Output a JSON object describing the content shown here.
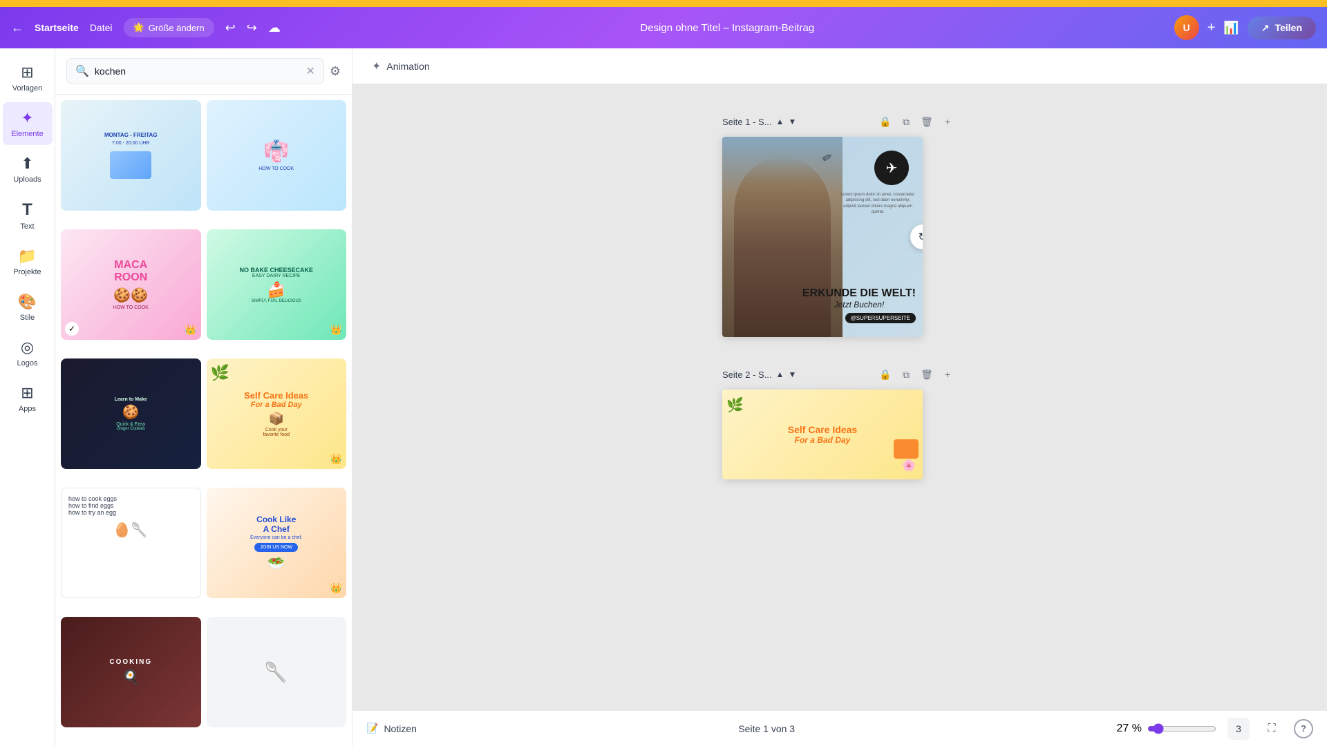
{
  "topbar": {
    "home_label": "Startseite",
    "file_label": "Datei",
    "resize_label": "Größe ändern",
    "title": "Design ohne Titel – Instagram-Beitrag",
    "share_label": "Teilen",
    "undo_icon": "↩",
    "redo_icon": "↪",
    "cloud_icon": "☁",
    "plus_icon": "+",
    "stats_icon": "📊"
  },
  "sidebar": {
    "items": [
      {
        "id": "vorlagen",
        "label": "Vorlagen",
        "icon": "⊞",
        "active": false
      },
      {
        "id": "elemente",
        "label": "Elemente",
        "icon": "✦",
        "active": true
      },
      {
        "id": "uploads",
        "label": "Uploads",
        "icon": "⬆",
        "active": false
      },
      {
        "id": "text",
        "label": "Text",
        "icon": "T",
        "active": false
      },
      {
        "id": "projekte",
        "label": "Projekte",
        "icon": "📁",
        "active": false
      },
      {
        "id": "stile",
        "label": "Stile",
        "icon": "🎨",
        "active": false
      },
      {
        "id": "logos",
        "label": "Logos",
        "icon": "◎",
        "active": false
      },
      {
        "id": "apps",
        "label": "Apps",
        "icon": "⊞",
        "active": false
      }
    ]
  },
  "search": {
    "query": "kochen",
    "placeholder": "kochen",
    "clear_label": "×",
    "filter_icon": "⚙"
  },
  "canvas": {
    "animation_label": "Animation",
    "page1_label": "Seite 1 - S...",
    "page2_label": "Seite 2 - S...",
    "page1_design": {
      "title": "ERKUNDE DIE WELT!",
      "script": "Jetzt Buchen!",
      "handle": "@SUPERSUPERSEITE",
      "lorem": "Lorem ipsum dolor sit amet, consectetur adipiscing elit, sed diam nonummy, adipisit laoreet dolore magna aliquam querat."
    },
    "page2_design": {
      "title": "Self Care Ideas",
      "subtitle": "For a Bad Day"
    }
  },
  "bottombar": {
    "notes_label": "Notizen",
    "page_indicator": "Seite 1 von 3",
    "zoom_percent": "27 %",
    "help_label": "?"
  },
  "results": [
    {
      "id": 1,
      "type": "schedule",
      "premium": false,
      "bg": "blue"
    },
    {
      "id": 2,
      "type": "tutorial",
      "premium": false,
      "bg": "light-blue"
    },
    {
      "id": 3,
      "type": "macaroon",
      "premium": true,
      "bg": "pink"
    },
    {
      "id": 4,
      "type": "cheesecake",
      "premium": true,
      "bg": "green"
    },
    {
      "id": 5,
      "type": "bake",
      "premium": false,
      "bg": "dark"
    },
    {
      "id": 6,
      "type": "selfcare",
      "premium": true,
      "bg": "yellow"
    },
    {
      "id": 7,
      "type": "eggs",
      "premium": false,
      "bg": "white"
    },
    {
      "id": 8,
      "type": "chef",
      "premium": true,
      "bg": "chef"
    },
    {
      "id": 9,
      "type": "cooking",
      "premium": false,
      "bg": "dark-red"
    },
    {
      "id": 10,
      "type": "half",
      "premium": false,
      "bg": "gray"
    }
  ]
}
